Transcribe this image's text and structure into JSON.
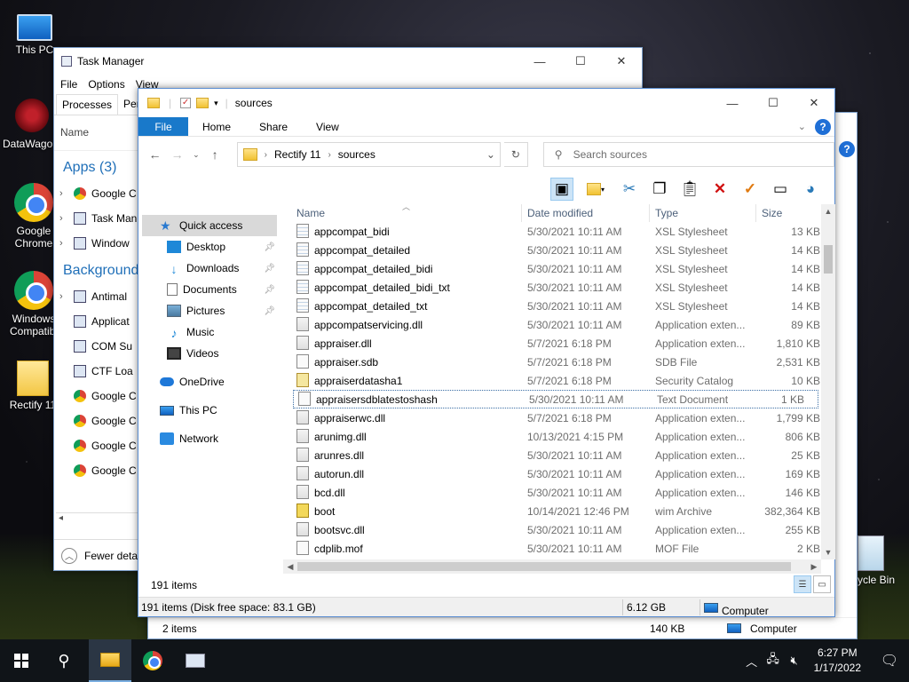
{
  "desktop": {
    "icons": [
      {
        "label": "This PC"
      },
      {
        "label": "DataWago"
      },
      {
        "label": "Google Chrome"
      },
      {
        "label": "Windows Compatibi"
      },
      {
        "label": "Rectify 11"
      },
      {
        "label": "ycle Bin"
      }
    ]
  },
  "task_manager": {
    "title": "Task Manager",
    "menu": [
      "File",
      "Options",
      "View"
    ],
    "tabs": [
      "Processes",
      "Perfo"
    ],
    "column_name": "Name",
    "apps_heading": "Apps (3)",
    "apps": [
      "Google C",
      "Task Man",
      "Window"
    ],
    "background_heading": "Background",
    "background": [
      "Antimal",
      "Applicat",
      "COM Su",
      "CTF Loa",
      "Google C",
      "Google C",
      "Google C",
      "Google C"
    ],
    "fewer_details": "Fewer detai"
  },
  "back_explorer": {
    "items": "2 items",
    "size": "140 KB",
    "computer": "Computer"
  },
  "explorer": {
    "title": "sources",
    "ribbon_tabs": {
      "file": "File",
      "home": "Home",
      "share": "Share",
      "view": "View"
    },
    "address": {
      "parent": "Rectify 11",
      "current": "sources"
    },
    "search_placeholder": "Search sources",
    "nav": {
      "quick_access": "Quick access",
      "desktop": "Desktop",
      "downloads": "Downloads",
      "documents": "Documents",
      "pictures": "Pictures",
      "music": "Music",
      "videos": "Videos",
      "onedrive": "OneDrive",
      "this_pc": "This PC",
      "network": "Network"
    },
    "columns": {
      "name": "Name",
      "date": "Date modified",
      "type": "Type",
      "size": "Size"
    },
    "files": [
      {
        "name": "appcompat_bidi",
        "date": "5/30/2021 10:11 AM",
        "type": "XSL Stylesheet",
        "size": "13 KB",
        "icon": "xsl"
      },
      {
        "name": "appcompat_detailed",
        "date": "5/30/2021 10:11 AM",
        "type": "XSL Stylesheet",
        "size": "14 KB",
        "icon": "xsl"
      },
      {
        "name": "appcompat_detailed_bidi",
        "date": "5/30/2021 10:11 AM",
        "type": "XSL Stylesheet",
        "size": "14 KB",
        "icon": "xsl"
      },
      {
        "name": "appcompat_detailed_bidi_txt",
        "date": "5/30/2021 10:11 AM",
        "type": "XSL Stylesheet",
        "size": "14 KB",
        "icon": "xsl"
      },
      {
        "name": "appcompat_detailed_txt",
        "date": "5/30/2021 10:11 AM",
        "type": "XSL Stylesheet",
        "size": "14 KB",
        "icon": "xsl"
      },
      {
        "name": "appcompatservicing.dll",
        "date": "5/30/2021 10:11 AM",
        "type": "Application exten...",
        "size": "89 KB",
        "icon": "dll"
      },
      {
        "name": "appraiser.dll",
        "date": "5/7/2021 6:18 PM",
        "type": "Application exten...",
        "size": "1,810 KB",
        "icon": "dll"
      },
      {
        "name": "appraiser.sdb",
        "date": "5/7/2021 6:18 PM",
        "type": "SDB File",
        "size": "2,531 KB",
        "icon": "file"
      },
      {
        "name": "appraiserdatasha1",
        "date": "5/7/2021 6:18 PM",
        "type": "Security Catalog",
        "size": "10 KB",
        "icon": "cat"
      },
      {
        "name": "appraisersdblatestoshash",
        "date": "5/30/2021 10:11 AM",
        "type": "Text Document",
        "size": "1 KB",
        "icon": "file",
        "focus": true
      },
      {
        "name": "appraiserwc.dll",
        "date": "5/7/2021 6:18 PM",
        "type": "Application exten...",
        "size": "1,799 KB",
        "icon": "dll"
      },
      {
        "name": "arunimg.dll",
        "date": "10/13/2021 4:15 PM",
        "type": "Application exten...",
        "size": "806 KB",
        "icon": "dll"
      },
      {
        "name": "arunres.dll",
        "date": "5/30/2021 10:11 AM",
        "type": "Application exten...",
        "size": "25 KB",
        "icon": "dll"
      },
      {
        "name": "autorun.dll",
        "date": "5/30/2021 10:11 AM",
        "type": "Application exten...",
        "size": "169 KB",
        "icon": "dll"
      },
      {
        "name": "bcd.dll",
        "date": "5/30/2021 10:11 AM",
        "type": "Application exten...",
        "size": "146 KB",
        "icon": "dll"
      },
      {
        "name": "boot",
        "date": "10/14/2021 12:46 PM",
        "type": "wim Archive",
        "size": "382,364 KB",
        "icon": "wim"
      },
      {
        "name": "bootsvc.dll",
        "date": "5/30/2021 10:11 AM",
        "type": "Application exten...",
        "size": "255 KB",
        "icon": "dll"
      },
      {
        "name": "cdplib.mof",
        "date": "5/30/2021 10:11 AM",
        "type": "MOF File",
        "size": "2 KB",
        "icon": "file"
      }
    ],
    "item_count": "191 items",
    "status": {
      "left": "191 items (Disk free space: 83.1 GB)",
      "size": "6.12 GB",
      "computer": "Computer"
    }
  },
  "taskbar": {
    "time": "6:27 PM",
    "date": "1/17/2022"
  }
}
